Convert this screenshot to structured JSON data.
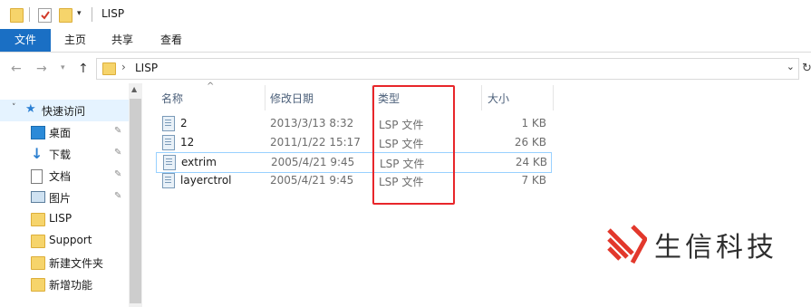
{
  "titlebar": {
    "title": "LISP"
  },
  "ribbon": {
    "tabs": [
      "文件",
      "主页",
      "共享",
      "查看"
    ]
  },
  "address": {
    "path_item": "LISP",
    "separator": "›"
  },
  "navpane": {
    "items": [
      {
        "label": "快速访问",
        "icon": "star-icon",
        "pinned": false,
        "active": true
      },
      {
        "label": "桌面",
        "icon": "desktop-icon",
        "pinned": true
      },
      {
        "label": "下载",
        "icon": "download-icon",
        "pinned": true
      },
      {
        "label": "文档",
        "icon": "document-icon",
        "pinned": true
      },
      {
        "label": "图片",
        "icon": "picture-icon",
        "pinned": true
      },
      {
        "label": "LISP",
        "icon": "folder-icon",
        "pinned": false
      },
      {
        "label": "Support",
        "icon": "folder-icon",
        "pinned": false
      },
      {
        "label": "新建文件夹",
        "icon": "folder-icon",
        "pinned": false
      },
      {
        "label": "新增功能",
        "icon": "folder-icon",
        "pinned": false
      }
    ]
  },
  "filelist": {
    "columns": [
      "名称",
      "修改日期",
      "类型",
      "大小"
    ],
    "rows": [
      {
        "name": "2",
        "date": "2013/3/13 8:32",
        "type": "LSP 文件",
        "size": "1 KB"
      },
      {
        "name": "12",
        "date": "2011/1/22 15:17",
        "type": "LSP 文件",
        "size": "26 KB"
      },
      {
        "name": "extrim",
        "date": "2005/4/21 9:45",
        "type": "LSP 文件",
        "size": "24 KB"
      },
      {
        "name": "layerctrol",
        "date": "2005/4/21 9:45",
        "type": "LSP 文件",
        "size": "7 KB"
      }
    ]
  },
  "watermark": {
    "text": "生信科技"
  },
  "colors": {
    "accent": "#1a6fc4",
    "highlight": "#e8262a",
    "folder": "#f6d46b",
    "logo_red": "#e2382c"
  }
}
